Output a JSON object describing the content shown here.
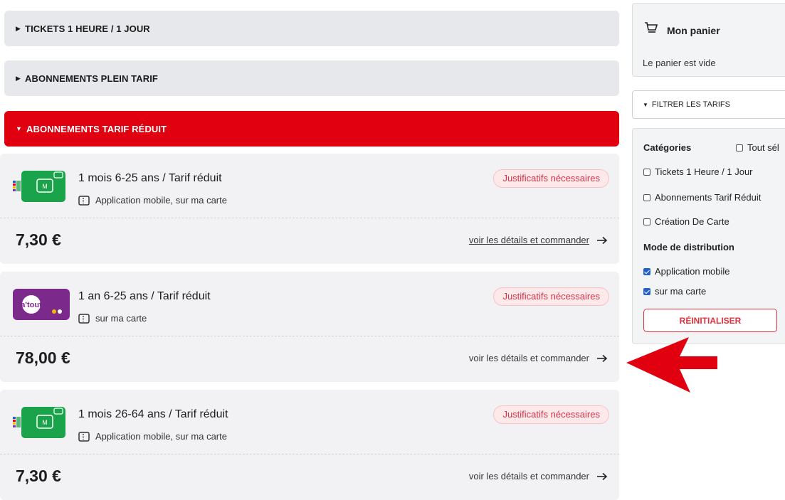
{
  "accordions": [
    {
      "label": "TICKETS 1 HEURE / 1 JOUR",
      "state": "collapsed"
    },
    {
      "label": "ABONNEMENTS PLEIN TARIF",
      "state": "collapsed"
    },
    {
      "label": "ABONNEMENTS TARIF RÉDUIT",
      "state": "expanded"
    }
  ],
  "products": [
    {
      "title": "1 mois 6-25 ans / Tarif réduit",
      "distribution": "Application mobile, sur ma carte",
      "badge": "Justificatifs nécessaires",
      "price": "7,30 €",
      "cta": "voir les détails et commander",
      "thumb": "navigo-card-green"
    },
    {
      "title": "1 an 6-25 ans / Tarif réduit",
      "distribution": "sur ma carte",
      "badge": "Justificatifs nécessaires",
      "price": "78,00 €",
      "cta": "voir les détails et commander",
      "thumb": "imagine-r-card-purple",
      "thumb_label": "a'tout"
    },
    {
      "title": "1 mois 26-64 ans / Tarif réduit",
      "distribution": "Application mobile, sur ma carte",
      "badge": "Justificatifs nécessaires",
      "price": "7,30 €",
      "cta": "voir les détails et commander",
      "thumb": "navigo-card-green"
    }
  ],
  "cart": {
    "title": "Mon panier",
    "empty_text": "Le panier est vide",
    "icon": "cart-icon"
  },
  "filter": {
    "toggle_label": "FILTRER LES TARIFS",
    "categories_heading": "Catégories",
    "select_all": "Tout sél",
    "categories": [
      {
        "label": "Tickets 1 Heure / 1 Jour",
        "checked": false
      },
      {
        "label": "Abonnements Tarif Réduit",
        "checked": false
      },
      {
        "label": "Création De Carte",
        "checked": false
      }
    ],
    "distribution_heading": "Mode de distribution",
    "distribution": [
      {
        "label": "Application mobile",
        "checked": true
      },
      {
        "label": "sur ma carte",
        "checked": true
      }
    ],
    "reset_label": "RÉINITIALISER"
  },
  "colors": {
    "brand_red": "#e0000f",
    "accordion_bg": "#e6e8eb",
    "card_bg": "#f2f2f4",
    "badge_text": "#d5354a",
    "checkbox_blue": "#2560c9"
  }
}
